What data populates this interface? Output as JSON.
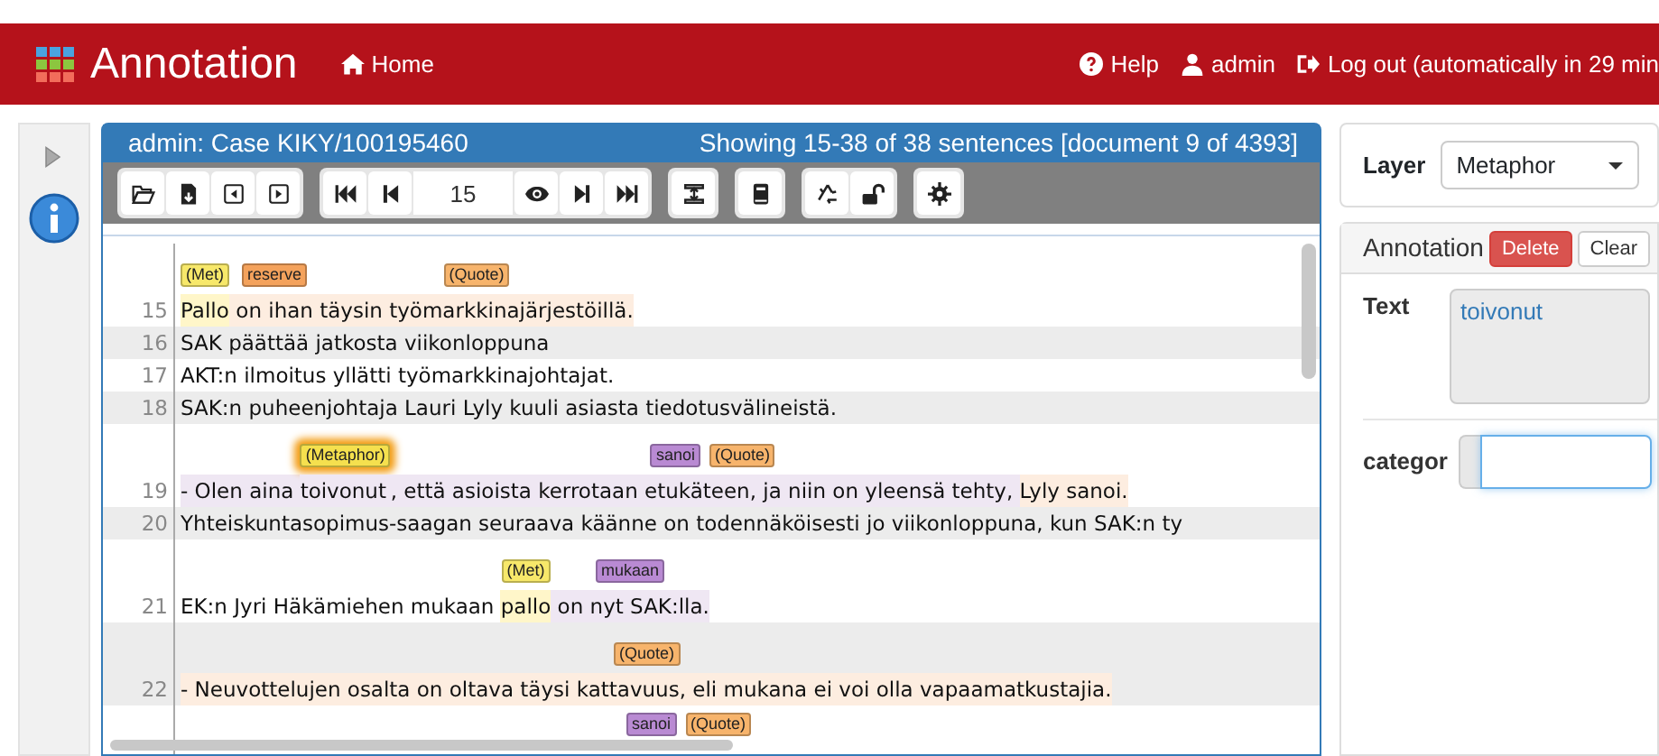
{
  "navbar": {
    "brand": "Annotation",
    "links": [
      {
        "label": "Home"
      }
    ],
    "right_links": [
      {
        "label": "Help"
      },
      {
        "label": "admin"
      },
      {
        "label": "Log out (automatically in 29 min"
      }
    ]
  },
  "document_panel": {
    "title": "admin: Case KIKY/100195460",
    "status": "Showing 15-38 of 38 sentences [document 9 of 4393]",
    "sentence_input": "15",
    "sentences": [
      {
        "kind": "sentence",
        "number": "15",
        "color": "#fdede0",
        "segments": [
          {
            "text": "Pallo",
            "color": "#fff6c9",
            "labels": [
              {
                "text": "(Met)",
                "color": "#f7e86a",
                "selected": false
              }
            ]
          },
          {
            "text": " on ihan ",
            "labels": [
              {
                "text": "reserve",
                "color": "#f4a25c",
                "selected": false
              }
            ]
          },
          {
            "text": "täysin työmarkkinajärjestöillä.",
            "labels": [
              {
                "text": "(Quote)",
                "color": "#f7b46c",
                "selected": false
              }
            ]
          }
        ]
      },
      {
        "kind": "sentence",
        "number": "16",
        "segments": [
          {
            "text": "SAK päättää jatkosta viikonloppuna"
          }
        ]
      },
      {
        "kind": "sentence",
        "number": "17",
        "segments": [
          {
            "text": "AKT:n ilmoitus yllätti työmarkkinajohtajat."
          }
        ]
      },
      {
        "kind": "sentence",
        "number": "18",
        "segments": [
          {
            "text": "SAK:n puheenjohtaja Lauri Lyly kuuli asiasta tiedotusvälineistä."
          }
        ]
      },
      {
        "kind": "sentence",
        "number": "19",
        "color": "#efe7f3",
        "segments": [
          {
            "text": "- Olen aina "
          },
          {
            "text": "toivonut",
            "labels": [
              {
                "text": "(Metaphor)",
                "color": "#f5e04e",
                "selected": true
              }
            ]
          },
          {
            "text": ", että asioista kerrotaan "
          },
          {
            "text": "etukäteen, ja",
            "labels": [
              {
                "text": "sanoi",
                "color": "#b98ad3",
                "selected": false
              },
              {
                "text": "(Quote)",
                "color": "#f7b46c",
                "selected": false
              }
            ]
          },
          {
            "text": " niin on yleensä tehty, "
          },
          {
            "text": "Lyly sanoi.",
            "color": "#fdede0"
          }
        ]
      },
      {
        "kind": "sentence",
        "number": "20",
        "segments": [
          {
            "text": "Yhteiskuntasopimus-saagan seuraava käänne on todennäköisesti jo viikonloppuna, kun SAK:n ty"
          }
        ]
      },
      {
        "kind": "sentence",
        "number": "21",
        "segments": [
          {
            "text": "EK:n Jyri Häkämiehen mukaan "
          },
          {
            "text": "pallo",
            "color": "#fff6c9",
            "labels": [
              {
                "text": "(Met)",
                "color": "#f7e86a",
                "selected": false
              }
            ]
          },
          {
            "text": " on nyt SAK:lla.",
            "color": "#efe7f3",
            "labels": [
              {
                "text": "mukaan",
                "color": "#b98ad3",
                "selected": false
              }
            ]
          }
        ]
      },
      {
        "kind": "sentence",
        "number": "22",
        "color": "#fdede0",
        "segments": [
          {
            "text": "- Neuvottelujen osalta on oltava täysi "
          },
          {
            "text": "kattavuus, eli",
            "labels": [
              {
                "text": "(Quote)",
                "color": "#f7b46c",
                "selected": false
              }
            ]
          },
          {
            "text": " mukana ei voi olla vapaamatkustajia."
          }
        ]
      },
      {
        "kind": "labels-only",
        "labels": [
          {
            "text": "sanoi",
            "color": "#b98ad3",
            "selected": false
          },
          {
            "text": "(Quote)",
            "color": "#f7b46c",
            "selected": false
          }
        ]
      }
    ]
  },
  "layer": {
    "label": "Layer",
    "value": "Metaphor"
  },
  "annotation": {
    "title": "Annotation",
    "buttons": [
      {
        "label": "Delete",
        "kind": "danger"
      },
      {
        "label": "Clear",
        "kind": "plain"
      }
    ],
    "text_label": "Text",
    "text_value": "toivonut",
    "category_label": "categor",
    "category_focused": true
  }
}
